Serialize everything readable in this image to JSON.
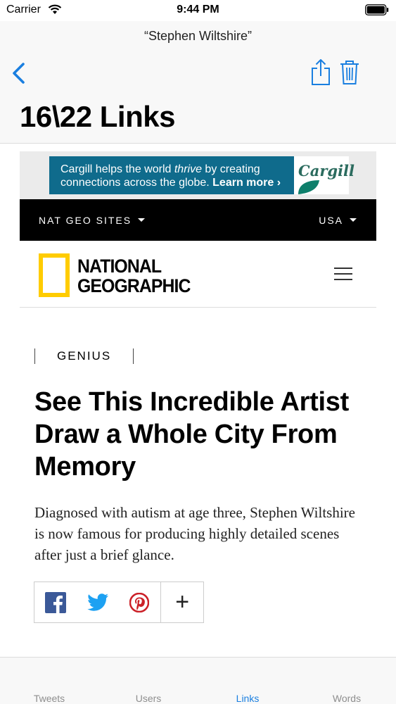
{
  "status_bar": {
    "carrier": "Carrier",
    "time": "9:44 PM"
  },
  "nav": {
    "subtitle": "“Stephen Wiltshire”",
    "title": "16\\22 Links",
    "accent_color": "#1a7fe0",
    "icons": [
      "back-chevron-icon",
      "share-icon",
      "trash-icon"
    ]
  },
  "ad": {
    "line1_pre": "Cargill helps the world ",
    "line1_em": "thrive",
    "line1_post": " by creating",
    "line2_pre": "connections across the globe. ",
    "line2_cta": "Learn more ›",
    "logo": "Cargill"
  },
  "natgeo": {
    "sites_label": "NAT GEO SITES",
    "region_label": "USA",
    "wordmark_line1": "NATIONAL",
    "wordmark_line2": "GEOGRAPHIC",
    "brand_yellow": "#ffcc00"
  },
  "article": {
    "kicker": "GENIUS",
    "headline": "See This Incredible Artist Draw a Whole City From Memory",
    "dek": "Diagnosed with autism at age three, Stephen Wiltshire is now famous for producing highly detailed scenes after just a brief glance."
  },
  "share_bar": {
    "icons": [
      "facebook-icon",
      "twitter-icon",
      "pinterest-icon",
      "plus-icon"
    ],
    "plus_label": "+"
  },
  "tabs": [
    {
      "label": "Tweets",
      "active": false
    },
    {
      "label": "Users",
      "active": false
    },
    {
      "label": "Links",
      "active": true
    },
    {
      "label": "Words",
      "active": false
    }
  ]
}
